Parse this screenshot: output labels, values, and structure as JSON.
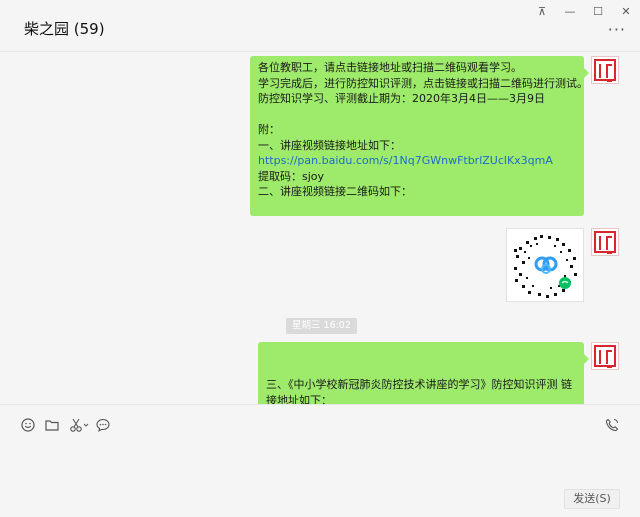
{
  "window": {
    "title": "柴之园 (59)",
    "controls": {
      "pin": "⊼",
      "minimize": "—",
      "maximize": "☐",
      "close": "✕"
    },
    "more": "···"
  },
  "messages": [
    {
      "lines": [
        "各位教职工，请点击链接地址或扫描二维码观看学习。",
        "学习完成后，进行防控知识评测，点击链接或扫描二维码进行测试。",
        "防控知识学习、评测截止期为：2020年3月4日——3月9日",
        "",
        "附：",
        "一、讲座视频链接地址如下：",
        "https://pan.baidu.com/s/1Nq7GWnwFtbrlZUclKx3qmA",
        "提取码：sjoy",
        "二、讲座视频链接二维码如下："
      ]
    },
    {
      "lines": [
        "",
        "",
        "三、《中小学校新冠肺炎防控技术讲座的学习》防控知识评测 链接地址如下："
      ]
    }
  ],
  "timestamp": "星期三 16:02",
  "toolbar": {
    "emoji_icon": "emoji-icon",
    "folder_icon": "folder-icon",
    "scissors_icon": "scissors-icon",
    "chat_icon": "chat-bubble-icon",
    "call_icon": "phone-icon"
  },
  "send_label": "发送(S)",
  "colors": {
    "bubble": "#9eea6a",
    "link": "#1b6ec9",
    "accent": "#07c160"
  }
}
